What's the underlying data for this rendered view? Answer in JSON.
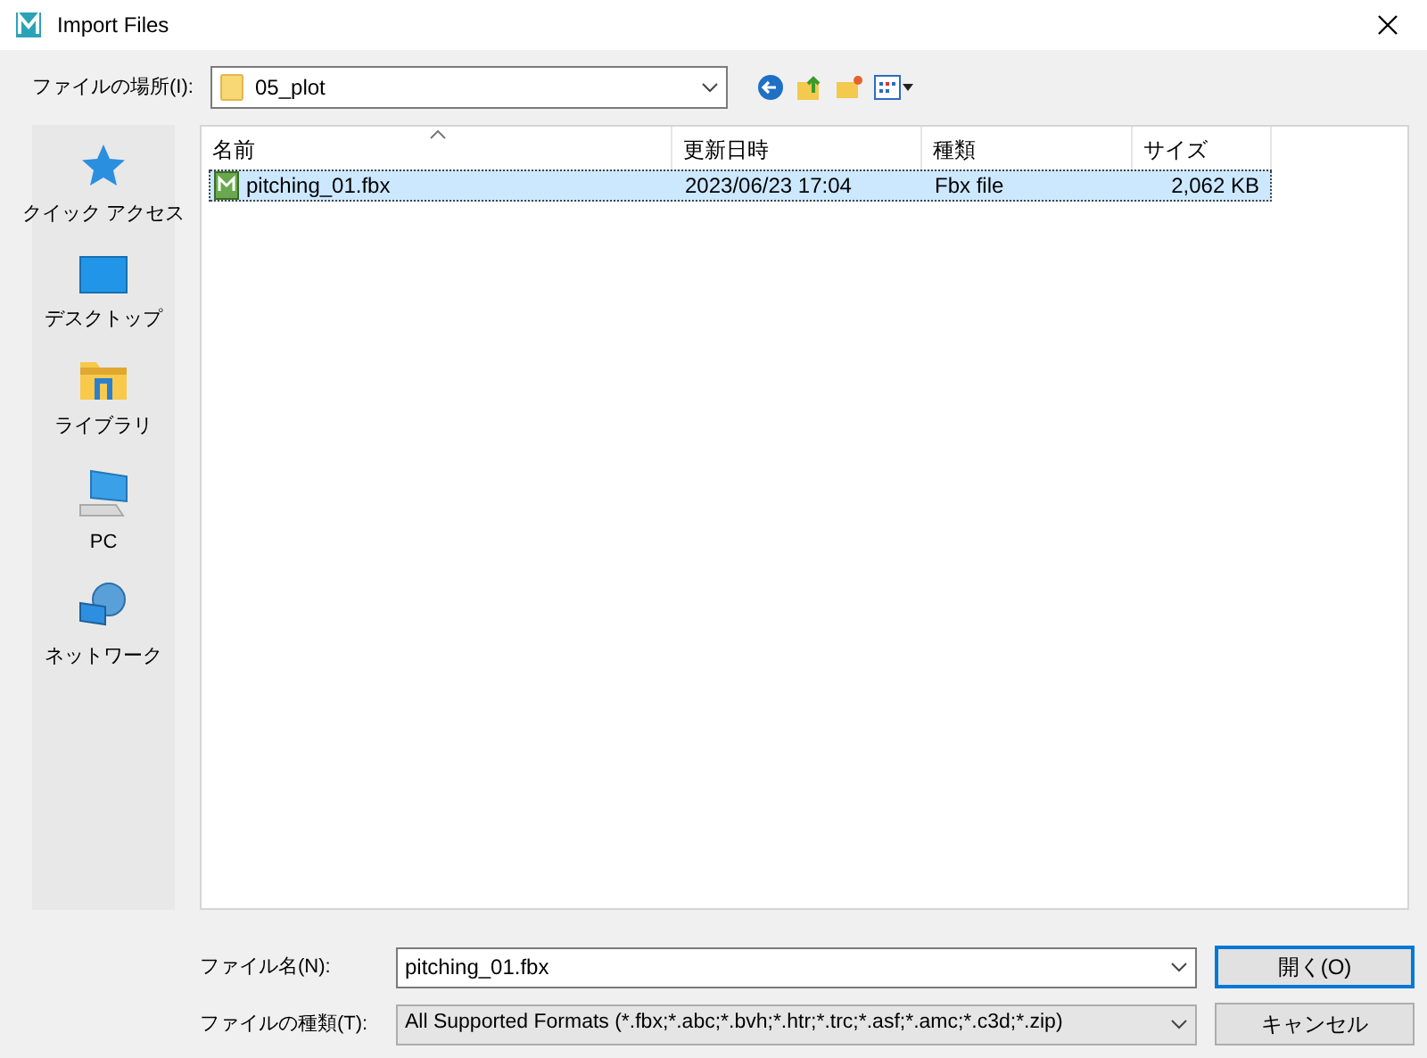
{
  "window": {
    "title": "Import Files"
  },
  "location": {
    "label": "ファイルの場所(I):",
    "value": "05_plot"
  },
  "sidebar": {
    "items": [
      {
        "kind": "star",
        "label": "クイック アクセス"
      },
      {
        "kind": "desktop",
        "label": "デスクトップ"
      },
      {
        "kind": "library",
        "label": "ライブラリ"
      },
      {
        "kind": "pc",
        "label": "PC"
      },
      {
        "kind": "network",
        "label": "ネットワーク"
      }
    ]
  },
  "table": {
    "columns": [
      "名前",
      "更新日時",
      "種類",
      "サイズ"
    ],
    "rows": [
      {
        "cells": [
          "pitching_01.fbx",
          "2023/06/23 17:04",
          "Fbx file",
          "2,062 KB"
        ],
        "selected": true
      }
    ]
  },
  "file_name": {
    "label": "ファイル名(N):",
    "value": "pitching_01.fbx"
  },
  "file_type": {
    "label": "ファイルの種類(T):",
    "value": "All Supported Formats (*.fbx;*.abc;*.bvh;*.htr;*.trc;*.asf;*.amc;*.c3d;*.zip)"
  },
  "buttons": [
    "開く(O)",
    "キャンセル"
  ]
}
